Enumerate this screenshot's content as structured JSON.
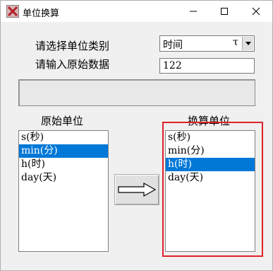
{
  "window": {
    "title": "单位换算"
  },
  "form": {
    "category_label": "请选择单位类别",
    "input_label": "请输入原始数据",
    "category_value": "时间",
    "category_mark": "τ",
    "input_value": "122",
    "result_text": ""
  },
  "source": {
    "title": "原始单位",
    "items": [
      {
        "label": "s(秒)"
      },
      {
        "label": "min(分)"
      },
      {
        "label": "h(时)"
      },
      {
        "label": "day(天)"
      }
    ],
    "selected_index": 1
  },
  "target": {
    "title": "换算单位",
    "items": [
      {
        "label": "s(秒)"
      },
      {
        "label": "min(分)"
      },
      {
        "label": "h(时)"
      },
      {
        "label": "day(天)"
      }
    ],
    "selected_index": 2
  },
  "colors": {
    "selection": "#0078d7",
    "highlight": "#e0202a"
  },
  "icons": {
    "app": "app-x-icon",
    "minimize": "minimize-icon",
    "maximize": "maximize-icon",
    "close": "close-icon",
    "dropdown": "dropdown-arrow-icon",
    "convert": "right-arrow-icon"
  }
}
